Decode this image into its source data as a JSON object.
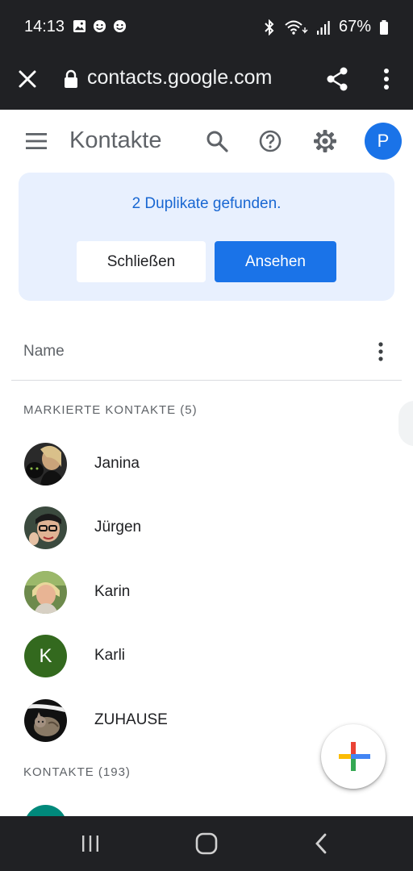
{
  "status": {
    "time": "14:13",
    "battery": "67%",
    "left_icons": [
      "gallery-icon",
      "sync-icon",
      "sync-icon"
    ],
    "right_icons": [
      "bluetooth-icon",
      "wifi-icon",
      "signal-icon",
      "battery-icon"
    ]
  },
  "browser": {
    "url": "contacts.google.com"
  },
  "app": {
    "title": "Kontakte",
    "account_initial": "P",
    "accent": "#1a73e8"
  },
  "banner": {
    "message": "2 Duplikate gefunden.",
    "close_label": "Schließen",
    "view_label": "Ansehen"
  },
  "list": {
    "sort_label": "Name",
    "starred_header": "MARKIERTE KONTAKTE (5)",
    "contacts_header": "KONTAKTE (193)",
    "starred": [
      {
        "name": "Janina",
        "avatar": "photo"
      },
      {
        "name": "Jürgen",
        "avatar": "photo"
      },
      {
        "name": "Karin",
        "avatar": "photo"
      },
      {
        "name": "Karli",
        "avatar": "letter",
        "initial": "K",
        "color": "#33691e"
      },
      {
        "name": "ZUHAUSE",
        "avatar": "photo"
      }
    ]
  }
}
